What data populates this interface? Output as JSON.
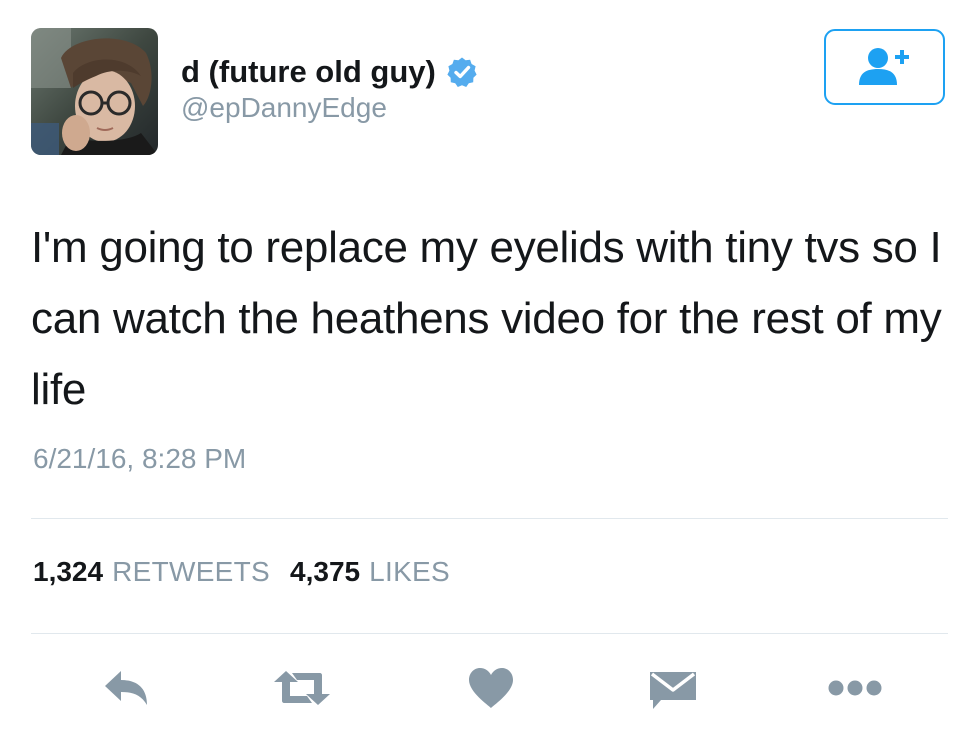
{
  "author": {
    "display_name": "d (future old guy)",
    "handle": "@epDannyEdge",
    "verified": true,
    "avatar_icon": "profile-photo"
  },
  "follow_button": {
    "icon": "add-user-icon"
  },
  "tweet": {
    "text": "I'm going to replace my eyelids with tiny tvs so I can watch the heathens video for the rest of my life",
    "timestamp": "6/21/16, 8:28 PM"
  },
  "stats": {
    "retweets_count": "1,324",
    "retweets_label": "RETWEETS",
    "likes_count": "4,375",
    "likes_label": "LIKES"
  },
  "actions": [
    "reply-icon",
    "retweet-icon",
    "like-icon",
    "direct-message-icon",
    "more-icon"
  ],
  "colors": {
    "accent": "#1da1f2",
    "verified": "#55acee",
    "secondary_text": "#8899a6",
    "action_icon": "#8899a6",
    "divider": "#e1e8ed"
  }
}
